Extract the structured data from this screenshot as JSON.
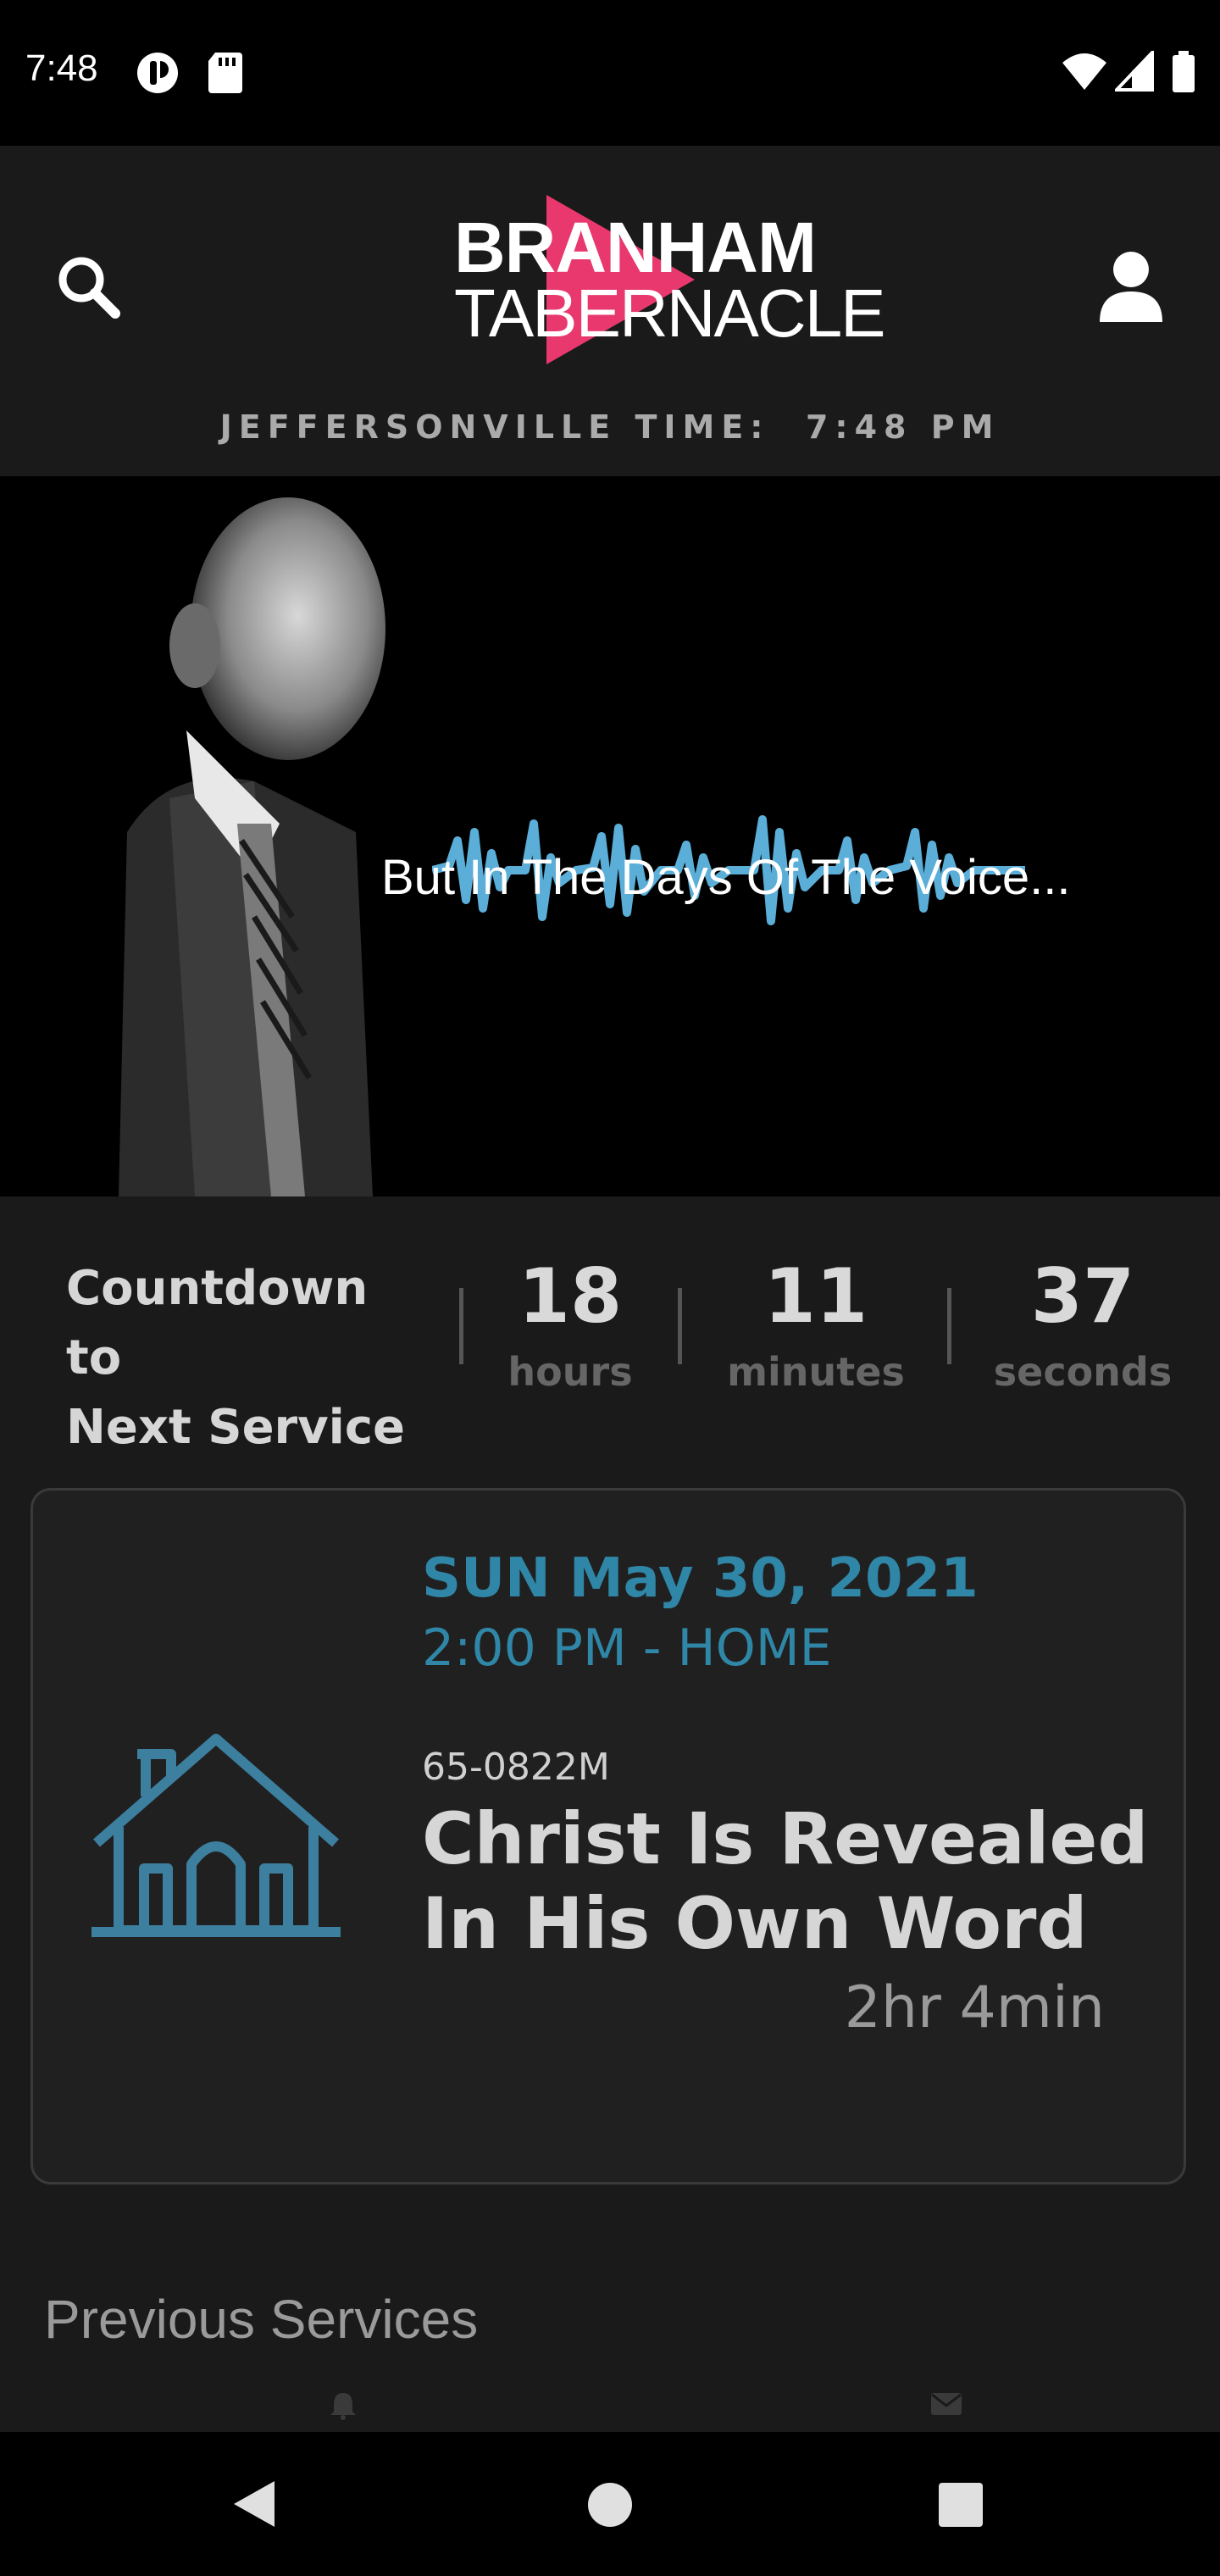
{
  "status_bar": {
    "time": "7:48",
    "left_icons": [
      "notification-app-icon",
      "sd-card-icon"
    ],
    "right_icons": [
      "wifi-icon",
      "cell-signal-icon",
      "battery-icon"
    ]
  },
  "header": {
    "logo_line1": "BRANHAM",
    "logo_line2": "TABERNACLE",
    "search_icon": "search-icon",
    "profile_icon": "user-icon",
    "time_label": "JEFFERSONVILLE TIME:",
    "time_value": "7:48 PM"
  },
  "hero": {
    "caption": "But In The Days Of The Voice...",
    "waveform_color": "#5aaed8"
  },
  "countdown": {
    "label_line1": "Countdown to",
    "label_line2": "Next Service",
    "hours": "18",
    "hours_label": "hours",
    "minutes": "11",
    "minutes_label": "minutes",
    "seconds": "37",
    "seconds_label": "seconds"
  },
  "service": {
    "date": "SUN May 30, 2021",
    "time_location": "2:00 PM - HOME",
    "code": "65-0822M",
    "title_line1": "Christ Is Revealed",
    "title_line2": "In His Own Word",
    "duration": "2hr 4min",
    "icon": "home-icon",
    "accent_color": "#2f86a6"
  },
  "previous": {
    "title": "Previous Services"
  },
  "nav_bar": {
    "back": "back-icon",
    "home": "home-circle-icon",
    "recents": "recents-icon"
  }
}
